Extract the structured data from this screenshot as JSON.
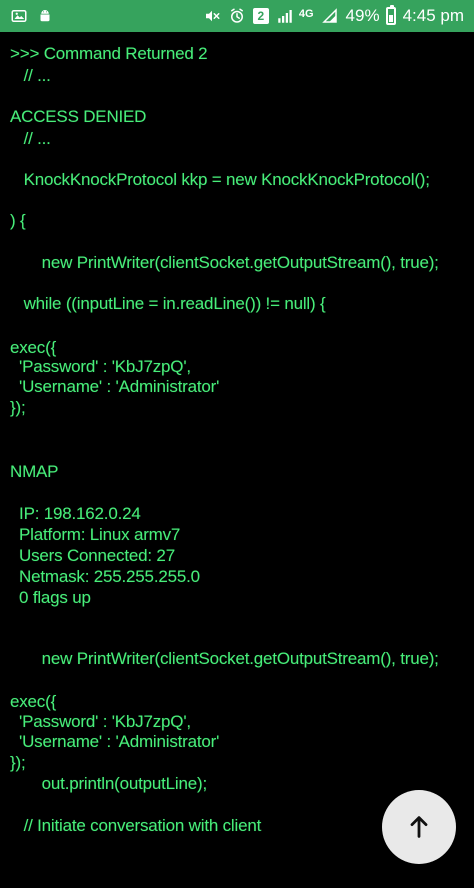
{
  "status_bar": {
    "battery_percent": "49%",
    "time": "4:45 pm",
    "network_type": "4G",
    "notification_badge": "2",
    "battery_level": 0.49,
    "icons": {
      "left": [
        "gallery-icon",
        "android-icon"
      ],
      "right": [
        "mute-icon",
        "alarm-icon",
        "badge-icon",
        "signal-icon",
        "network-4g-icon",
        "battery-icon"
      ]
    }
  },
  "terminal": {
    "text_color": "#48ee7a",
    "background": "#000000",
    "lines": [
      ">>> Command Returned 2",
      "   // ...",
      "ACCESS DENIED",
      "   // ...",
      "   KnockKnockProtocol kkp = new KnockKnockProtocol();",
      ") {",
      "       new PrintWriter(clientSocket.getOutputStream(), true);",
      "   while ((inputLine = in.readLine()) != null) {",
      "exec({",
      "  'Password' : 'KbJ7zpQ',",
      "  'Username' : 'Administrator'",
      "});",
      "NMAP",
      "  IP: 198.162.0.24",
      "  Platform: Linux armv7",
      "  Users Connected: 27",
      "  Netmask: 255.255.255.0",
      "  0 flags up",
      "       new PrintWriter(clientSocket.getOutputStream(), true);",
      "exec({",
      "  'Password' : 'KbJ7zpQ',",
      "  'Username' : 'Administrator'",
      "});",
      "       out.println(outputLine);",
      "   // Initiate conversation with client"
    ]
  },
  "fab": {
    "icon": "arrow-up-icon"
  },
  "colors": {
    "status_bar": "#36a35d",
    "terminal_text": "#48ee7a",
    "fab_background": "#e9e9e9",
    "fab_icon": "#111111"
  }
}
